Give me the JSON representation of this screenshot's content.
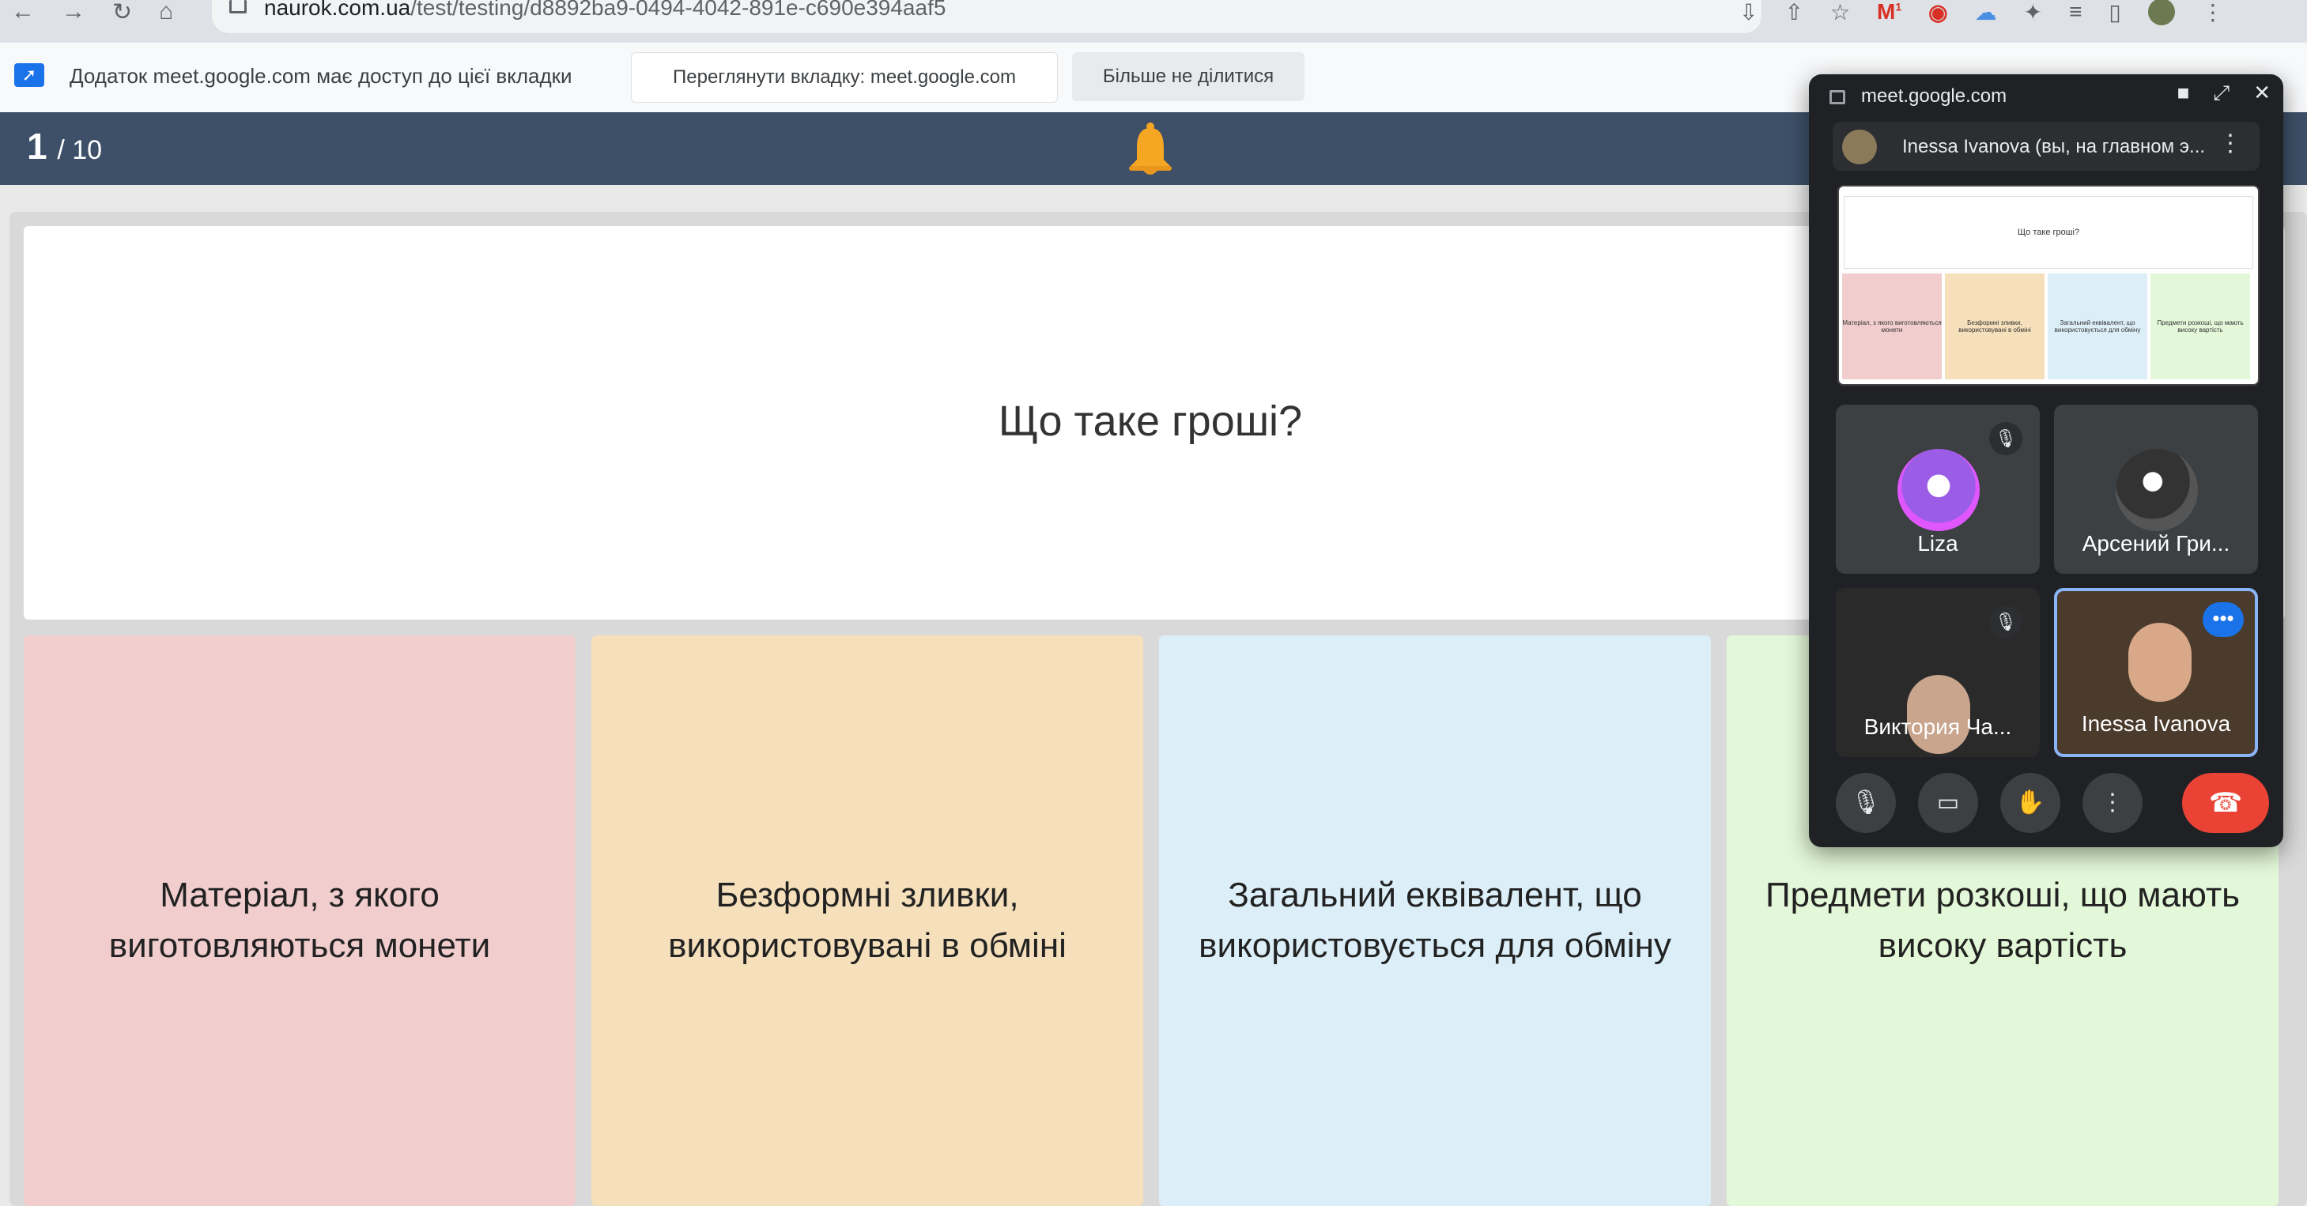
{
  "browser": {
    "url_host": "naurok.com.ua",
    "url_path": "/test/testing/d8892ba9-0494-4042-891e-c690e394aaf5",
    "nav_icons": [
      "back-icon",
      "forward-icon",
      "reload-icon",
      "home-icon"
    ],
    "ext_badge": "1"
  },
  "infobar": {
    "message": "Додаток meet.google.com має доступ до цієї вкладки",
    "view_button": "Переглянути вкладку: meet.google.com",
    "stop_button": "Більше не ділитися"
  },
  "test": {
    "current": "1",
    "total": "/ 10",
    "question": "Що таке гроші?",
    "answers": [
      {
        "text": "Матеріал, з якого виготовляються монети",
        "color": "#f1cdcd"
      },
      {
        "text": "Безформні зливки, використовувані в обміні",
        "color": "#f6e0bb"
      },
      {
        "text": "Загальний еквівалент, що використовується для обміну",
        "color": "#dceff9"
      },
      {
        "text": "Предмети розкоші, що мають високу вартість",
        "color": "#e3f8d8"
      }
    ]
  },
  "meet": {
    "title": "meet.google.com",
    "presenter": "Inessa Ivanova (вы, на главном э...",
    "participants": [
      {
        "name": "Liza",
        "muted": true
      },
      {
        "name": "Арсений Гри...",
        "muted": false
      },
      {
        "name": "Виктория Ча...",
        "muted": true
      },
      {
        "name": "Inessa Ivanova",
        "muted": false
      }
    ]
  }
}
